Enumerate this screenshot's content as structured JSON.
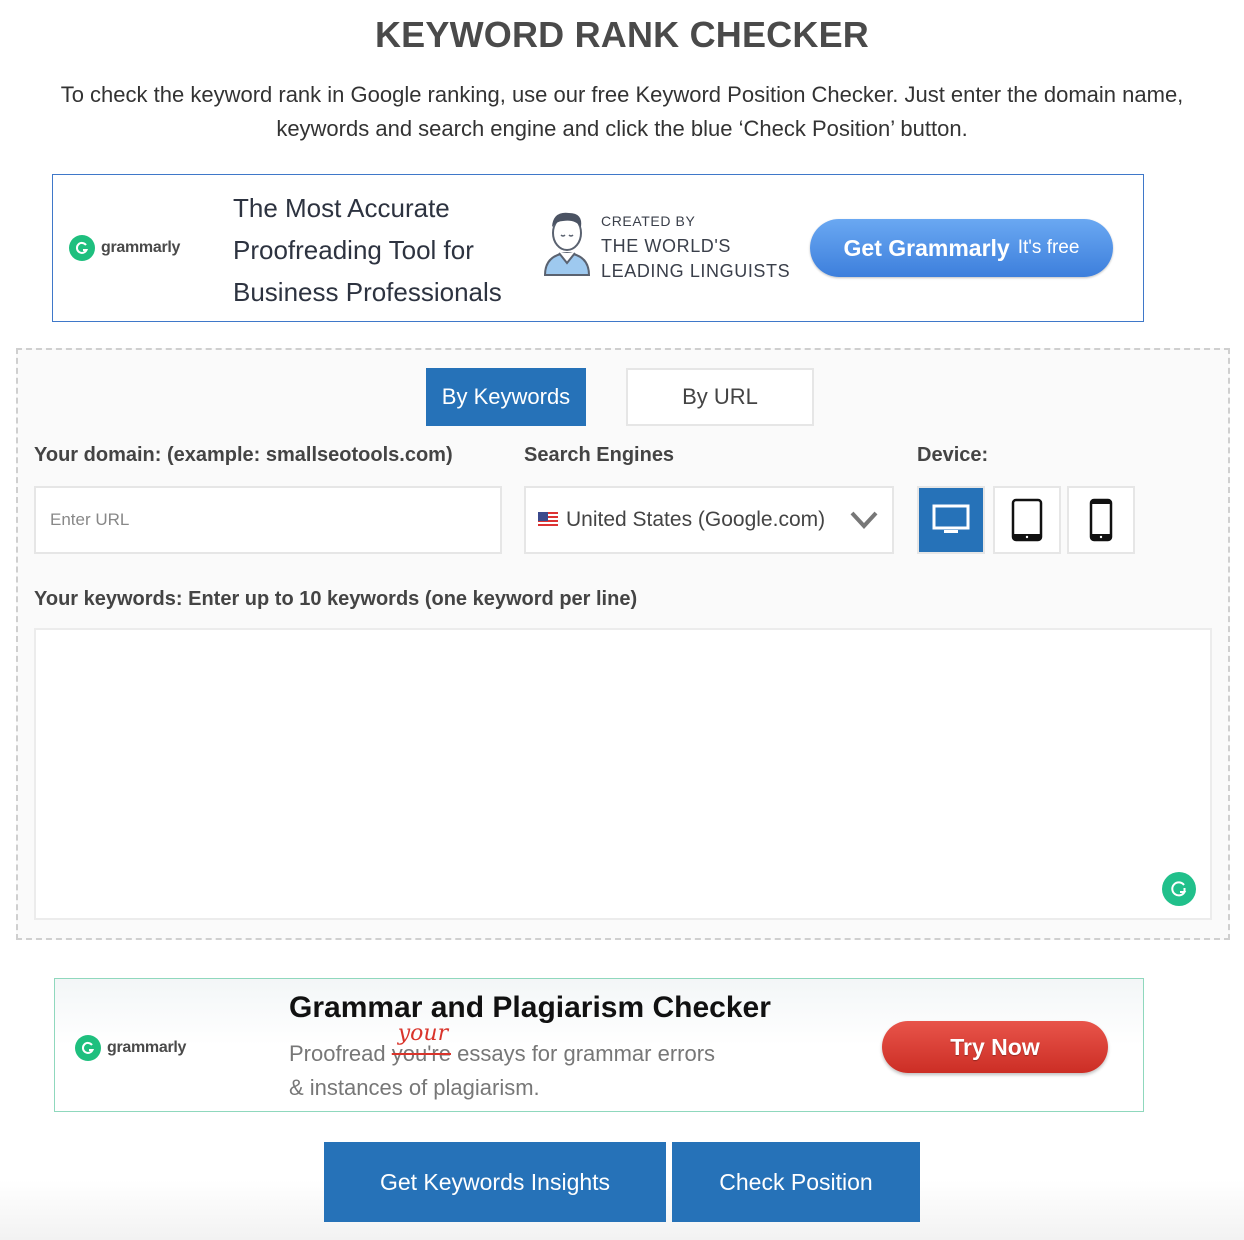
{
  "page": {
    "title": "KEYWORD RANK CHECKER",
    "intro": "To check the keyword rank in Google ranking, use our free Keyword Position Checker. Just enter the domain name, keywords and search engine and click the blue ‘Check Position’ button."
  },
  "ad_top": {
    "brand": "grammarly",
    "headline_lines": [
      "The Most Accurate",
      "Proofreading Tool for",
      "Business Professionals"
    ],
    "created_by": "CREATED BY",
    "created_lines": [
      "THE WORLD'S",
      "LEADING LINGUISTS"
    ],
    "cta_main": "Get Grammarly",
    "cta_sub": "It's free",
    "colors": {
      "button": "#4a8ae4",
      "border": "#3f78c9",
      "logo": "#1ebf7e"
    }
  },
  "form": {
    "tabs": [
      {
        "label": "By Keywords",
        "active": true
      },
      {
        "label": "By URL",
        "active": false
      }
    ],
    "domain_label": "Your domain: (example: smallseotools.com)",
    "domain_value": "",
    "domain_placeholder": "Enter URL",
    "engine_label": "Search Engines",
    "engine_selected": "United States (Google.com)",
    "engine_flag": "us-flag-icon",
    "device_label": "Device:",
    "devices": [
      {
        "name": "desktop",
        "icon": "desktop-icon",
        "active": true
      },
      {
        "name": "tablet",
        "icon": "tablet-icon",
        "active": false
      },
      {
        "name": "mobile",
        "icon": "mobile-icon",
        "active": false
      }
    ],
    "keywords_label": "Your keywords: Enter up to 10 keywords (one keyword per line)",
    "keywords_value": "",
    "accent": "#2672b8"
  },
  "ad_bottom": {
    "brand": "grammarly",
    "headline": "Grammar and Plagiarism Checker",
    "sub_prefix": "Proofread",
    "sub_struck": "you're",
    "sub_correction": "your",
    "sub_suffix": "essays for grammar errors",
    "sub_line2": "& instances of plagiarism.",
    "cta": "Try Now",
    "colors": {
      "button": "#d9392f",
      "border": "#8fd8bd"
    }
  },
  "actions": {
    "insights_label": "Get Keywords Insights",
    "check_label": "Check Position"
  }
}
